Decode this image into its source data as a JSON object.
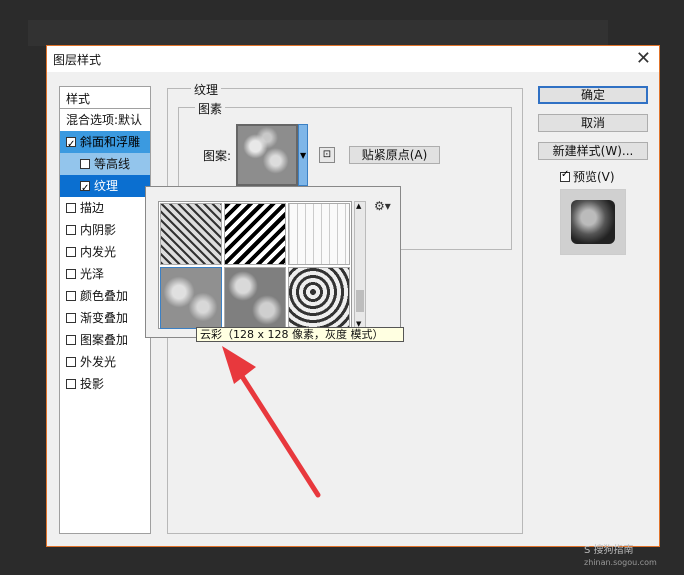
{
  "dialog": {
    "title": "图层样式"
  },
  "left": {
    "header": "样式",
    "blend_label": "混合选项:默认",
    "items": [
      {
        "label": "斜面和浮雕",
        "checked": true
      },
      {
        "label": "等高线",
        "checked": false
      },
      {
        "label": "纹理",
        "checked": true
      },
      {
        "label": "描边",
        "checked": false
      },
      {
        "label": "内阴影",
        "checked": false
      },
      {
        "label": "内发光",
        "checked": false
      },
      {
        "label": "光泽",
        "checked": false
      },
      {
        "label": "颜色叠加",
        "checked": false
      },
      {
        "label": "渐变叠加",
        "checked": false
      },
      {
        "label": "图案叠加",
        "checked": false
      },
      {
        "label": "外发光",
        "checked": false
      },
      {
        "label": "投影",
        "checked": false
      }
    ]
  },
  "texture": {
    "section_title": "纹理",
    "group_title": "图素",
    "pattern_label": "图案:",
    "snap_button": "贴紧原点(A)"
  },
  "buttons": {
    "ok": "确定",
    "cancel": "取消",
    "new_style": "新建样式(W)...",
    "preview": "预览(V)"
  },
  "popup": {
    "tooltip": "云彩（128 x 128 像素，灰度 模式）"
  },
  "watermark": {
    "line1": "S 搜狗指南",
    "line2": "zhinan.sogou.com"
  },
  "colors": {
    "accent": "#e0732a",
    "selection": "#3b9ae0",
    "arrow": "#e8383d"
  }
}
